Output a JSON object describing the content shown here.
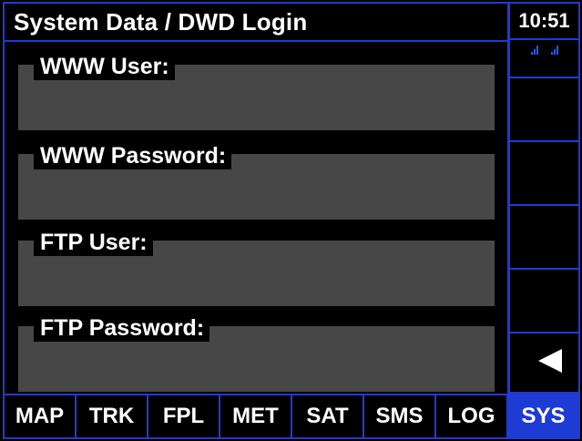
{
  "header": {
    "title": "System Data / DWD Login",
    "time": "10:51"
  },
  "fields": [
    {
      "label": "WWW User:",
      "value": ""
    },
    {
      "label": "WWW Password:",
      "value": ""
    },
    {
      "label": "FTP User:",
      "value": ""
    },
    {
      "label": "FTP Password:",
      "value": ""
    }
  ],
  "side": {
    "back_icon": "back-arrow-icon",
    "signal_icon": "signal-bars-icon"
  },
  "tabs": [
    {
      "label": "MAP"
    },
    {
      "label": "TRK"
    },
    {
      "label": "FPL"
    },
    {
      "label": "MET"
    },
    {
      "label": "SAT"
    },
    {
      "label": "SMS"
    },
    {
      "label": "LOG"
    },
    {
      "label": "SYS",
      "active": true
    }
  ],
  "colors": {
    "accent": "#1f3bd6",
    "field_bg": "#474747",
    "background": "#000000"
  }
}
